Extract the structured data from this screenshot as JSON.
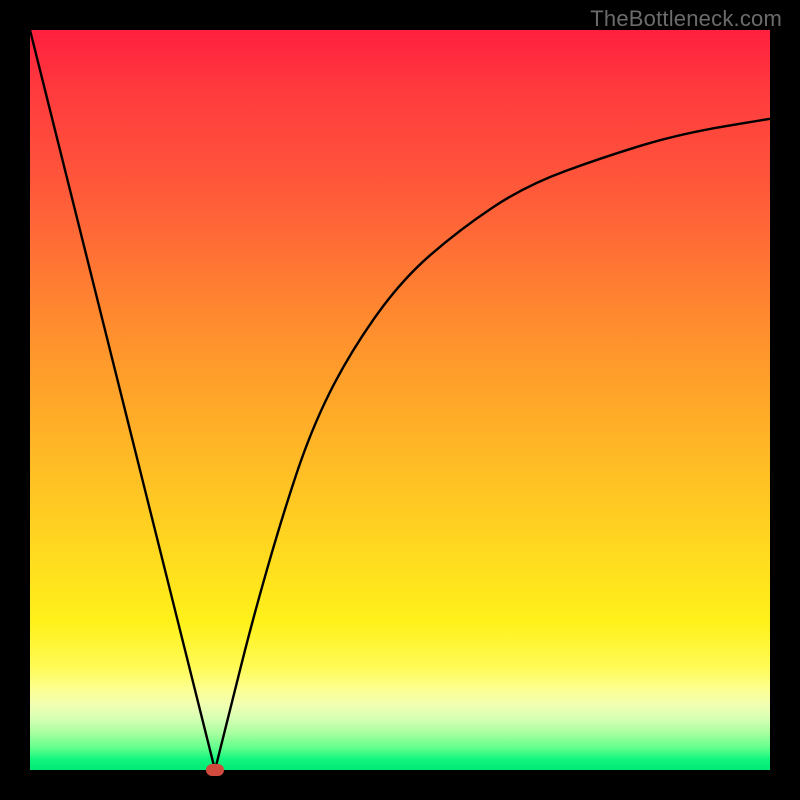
{
  "watermark": "TheBottleneck.com",
  "colors": {
    "background": "#000000",
    "curve": "#000000",
    "marker": "#d04a3d",
    "gradient_top": "#ff1f3f",
    "gradient_bottom": "#00e876"
  },
  "chart_data": {
    "type": "line",
    "title": "",
    "xlabel": "",
    "ylabel": "",
    "xlim": [
      0,
      100
    ],
    "ylim": [
      0,
      100
    ],
    "grid": false,
    "legend": false,
    "annotations": [
      {
        "text": "TheBottleneck.com",
        "position": "top-right"
      }
    ],
    "marker": {
      "x": 25,
      "y": 0,
      "color": "#d04a3d"
    },
    "series": [
      {
        "name": "left-branch",
        "x": [
          0,
          5,
          10,
          15,
          20,
          23,
          25
        ],
        "y": [
          100,
          80,
          60,
          40,
          20,
          8,
          0
        ]
      },
      {
        "name": "right-branch",
        "x": [
          25,
          27,
          30,
          34,
          38,
          43,
          50,
          58,
          67,
          78,
          88,
          100
        ],
        "y": [
          0,
          8,
          20,
          34,
          46,
          56,
          66,
          73,
          79,
          83,
          86,
          88
        ]
      }
    ],
    "background_gradient": {
      "direction": "vertical",
      "stops": [
        {
          "pos": 0.0,
          "color": "#ff1f3f"
        },
        {
          "pos": 0.4,
          "color": "#ff8d2e"
        },
        {
          "pos": 0.8,
          "color": "#fff11a"
        },
        {
          "pos": 0.93,
          "color": "#d7ffb5"
        },
        {
          "pos": 1.0,
          "color": "#00e876"
        }
      ]
    }
  }
}
